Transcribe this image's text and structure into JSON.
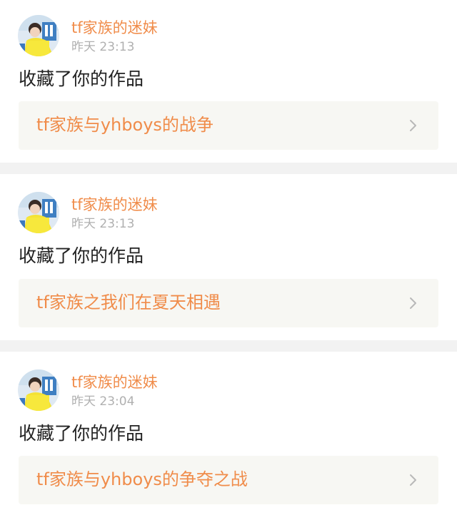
{
  "notifications": [
    {
      "username": "tf家族的迷妹",
      "time": "昨天 23:13",
      "action": "收藏了你的作品",
      "work_title": "tf家族与yhboys的战争",
      "chevron_icon": "chevron-right-icon",
      "avatar_icon": "avatar-image"
    },
    {
      "username": "tf家族的迷妹",
      "time": "昨天 23:13",
      "action": "收藏了你的作品",
      "work_title": "tf家族之我们在夏天相遇",
      "chevron_icon": "chevron-right-icon",
      "avatar_icon": "avatar-image"
    },
    {
      "username": "tf家族的迷妹",
      "time": "昨天 23:04",
      "action": "收藏了你的作品",
      "work_title": "tf家族与yhboys的争夺之战",
      "chevron_icon": "chevron-right-icon",
      "avatar_icon": "avatar-image"
    }
  ],
  "colors": {
    "accent": "#f08c4a",
    "timestamp": "#b0b0b0",
    "text": "#222222",
    "card_bg": "#ffffff",
    "work_bg": "#f7f7f3",
    "separator": "#f2f2f2"
  }
}
